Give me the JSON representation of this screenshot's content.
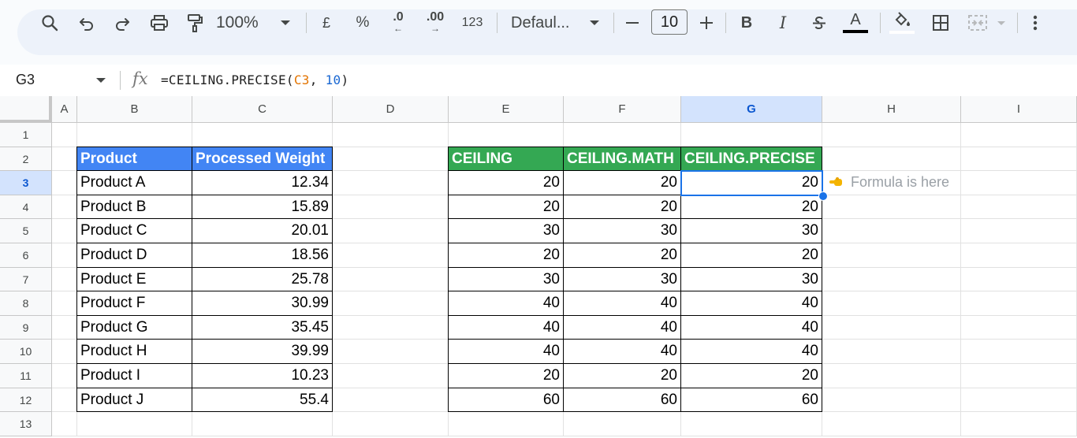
{
  "toolbar": {
    "zoom": "100%",
    "currency": "£",
    "percent": "%",
    "decrease_decimal": ".0",
    "increase_decimal": ".00",
    "number_format": "123",
    "font": "Defaul...",
    "font_size": "10",
    "bold": "B",
    "italic": "I",
    "text_color_letter": "A"
  },
  "formula_bar": {
    "cell_ref": "G3",
    "fx": "fx",
    "formula_prefix": "=CEILING.PRECISE(",
    "formula_ref": "C3",
    "formula_sep": ", ",
    "formula_arg": "10",
    "formula_suffix": ")"
  },
  "sheet": {
    "columns": [
      "A",
      "B",
      "C",
      "D",
      "E",
      "F",
      "G",
      "H",
      "I"
    ],
    "rows": [
      "1",
      "2",
      "3",
      "4",
      "5",
      "6",
      "7",
      "8",
      "9",
      "10",
      "11",
      "12",
      "13"
    ],
    "selected_column": "G",
    "selected_row": "3"
  },
  "table1": {
    "headers": [
      "Product",
      "Processed Weight"
    ],
    "rows": [
      [
        "Product A",
        "12.34"
      ],
      [
        "Product B",
        "15.89"
      ],
      [
        "Product C",
        "20.01"
      ],
      [
        "Product D",
        "18.56"
      ],
      [
        "Product E",
        "25.78"
      ],
      [
        "Product F",
        "30.99"
      ],
      [
        "Product G",
        "35.45"
      ],
      [
        "Product H",
        "39.99"
      ],
      [
        "Product I",
        "10.23"
      ],
      [
        "Product J",
        "55.4"
      ]
    ]
  },
  "table2": {
    "headers": [
      "CEILING",
      "CEILING.MATH",
      "CEILING.PRECISE"
    ],
    "rows": [
      [
        "20",
        "20",
        "20"
      ],
      [
        "20",
        "20",
        "20"
      ],
      [
        "30",
        "30",
        "30"
      ],
      [
        "20",
        "20",
        "20"
      ],
      [
        "30",
        "30",
        "30"
      ],
      [
        "40",
        "40",
        "40"
      ],
      [
        "40",
        "40",
        "40"
      ],
      [
        "40",
        "40",
        "40"
      ],
      [
        "20",
        "20",
        "20"
      ],
      [
        "60",
        "60",
        "60"
      ]
    ]
  },
  "note": {
    "text": "Formula is here",
    "icon": "pointing-hand-icon"
  },
  "colors": {
    "header_blue": "#4285f4",
    "header_green": "#34a853",
    "selection": "#1a73e8"
  }
}
